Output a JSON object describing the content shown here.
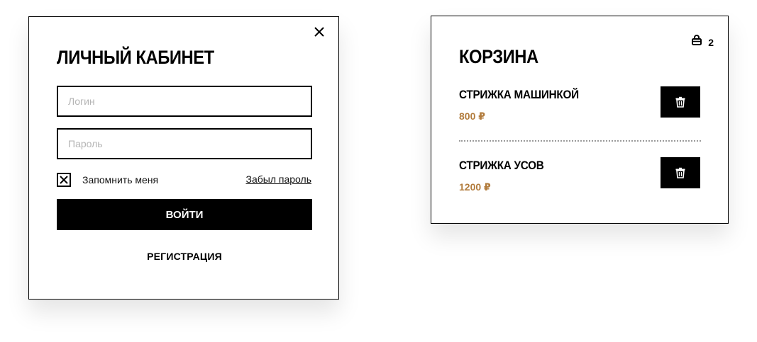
{
  "login": {
    "title": "ЛИЧНЫЙ КАБИНЕТ",
    "login_placeholder": "Логин",
    "password_placeholder": "Пароль",
    "remember_label": "Запомнить меня",
    "remember_checked": true,
    "forgot_link": "Забыл пароль",
    "submit_label": "ВОЙТИ",
    "register_link": "РЕГИСТРАЦИЯ",
    "close_icon": "close-icon"
  },
  "cart": {
    "title": "КОРЗИНА",
    "count": "2",
    "cart_icon": "basket-icon",
    "items": [
      {
        "name": "СТРИЖКА МАШИНКОЙ",
        "price": "800 ₽",
        "delete_icon": "trash-icon"
      },
      {
        "name": "СТРИЖКА УСОВ",
        "price": "1200 ₽",
        "delete_icon": "trash-icon"
      }
    ]
  },
  "colors": {
    "accent_price": "#b27c3d",
    "button_bg": "#000000",
    "border": "#000000"
  }
}
